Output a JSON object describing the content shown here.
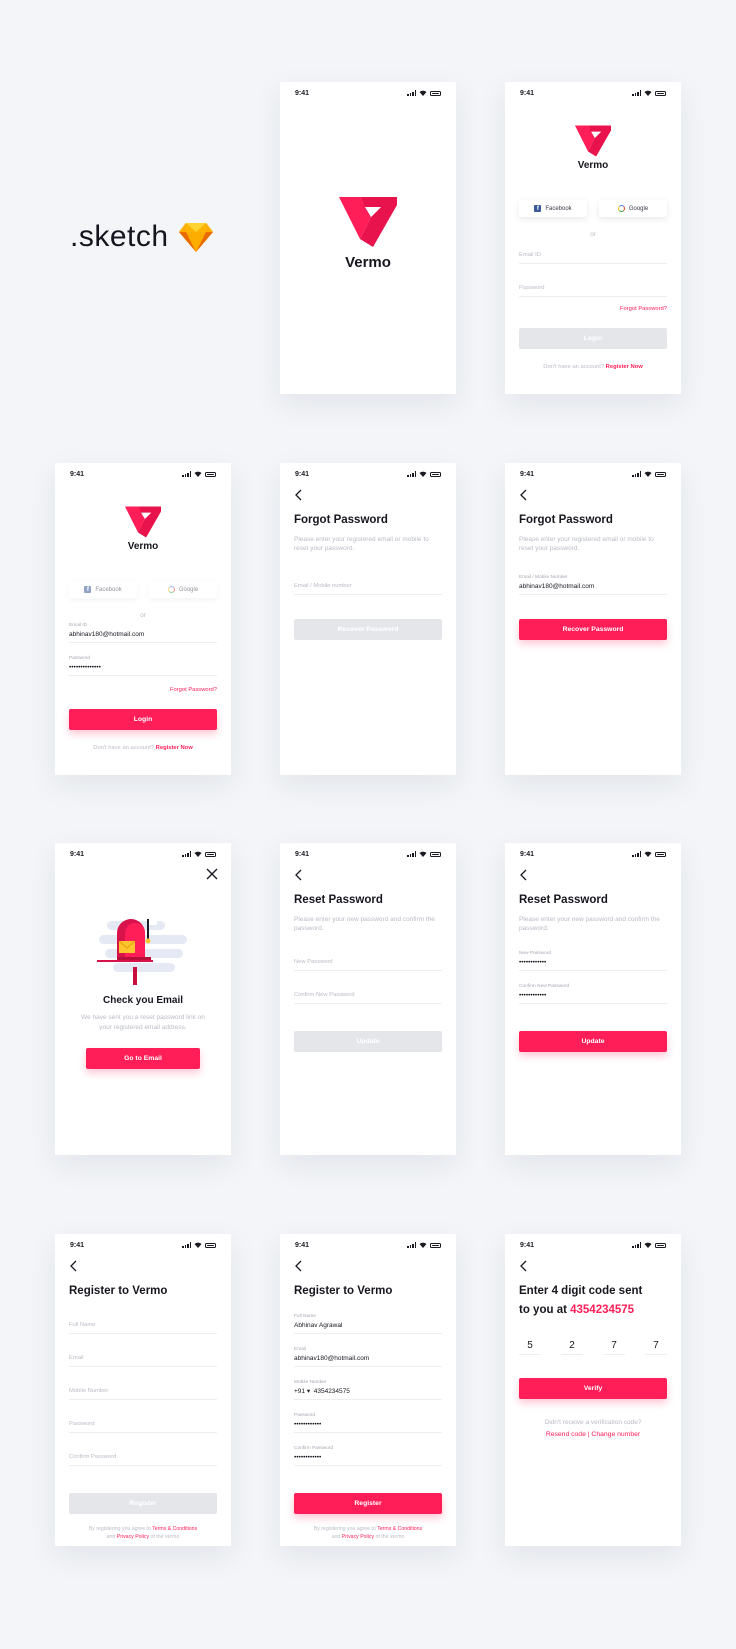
{
  "brand": {
    "name": "Vermo",
    "accent": "#ff1e57",
    "disabled": "#e4e6ea"
  },
  "label": ".sketch",
  "status": {
    "time": "9:41"
  },
  "social": {
    "facebook": "Facebook",
    "google": "Google",
    "or": "or"
  },
  "login": {
    "email_placeholder": "Email ID",
    "password_placeholder": "Password",
    "email_label": "Email ID",
    "password_label": "Password",
    "email_value": "abhinav180@hotmail.com",
    "password_value": "••••••••••••••",
    "forgot": "Forgot Password?",
    "button": "Login",
    "no_account": "Don't have an account?",
    "register_now": "Register Now"
  },
  "forgot": {
    "title": "Forgot Password",
    "desc": "Please enter your registered email or mobile to reset your password.",
    "field_placeholder": "Email / Mobile number",
    "field_label": "Email / Mobile Number",
    "field_value": "abhinav180@hotmail.com",
    "button": "Recover Password"
  },
  "check_email": {
    "title": "Check you Email",
    "desc": "We have sent you a reset password link on your registered email address.",
    "button": "Go to Email"
  },
  "reset": {
    "title": "Reset Password",
    "desc": "Please enter your new password and confirm the password.",
    "new_placeholder": "New Password",
    "confirm_placeholder": "Confirm New Password",
    "new_value": "••••••••••••",
    "confirm_value": "••••••••••••",
    "button": "Update"
  },
  "register": {
    "title": "Register to Vermo",
    "full_name": "Full Name",
    "email": "Email",
    "mobile": "Mobile Number",
    "password": "Password",
    "confirm_password": "Confirm Password",
    "full_name_value": "Abhinav Agrawal",
    "email_value": "abhinav180@hotmail.com",
    "country_code": "+91 ▾",
    "mobile_value": "4354234575",
    "password_value": "••••••••••••",
    "confirm_value": "••••••••••••",
    "button": "Register",
    "terms_prefix": "By registering you agree to",
    "terms": "Terms & Conditions",
    "and": "and",
    "privacy": "Privacy Policy",
    "terms_suffix": "of the vermo"
  },
  "verify": {
    "title_line1": "Enter 4 digit code sent",
    "title_line2": "to you at",
    "phone": "4354234575",
    "digits": [
      "5",
      "2",
      "7",
      "7"
    ],
    "button": "Verify",
    "no_code": "Didn't receive a verification code?",
    "resend": "Resend code",
    "sep": "|",
    "change": "Change number"
  }
}
